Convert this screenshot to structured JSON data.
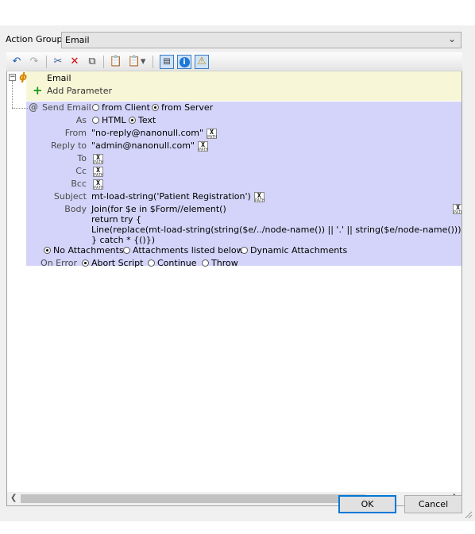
{
  "action_group": {
    "label": "Action Group:",
    "value": "Email"
  },
  "toolbar": {
    "undo": "undo-icon",
    "redo": "redo-icon",
    "cut": "cut-icon",
    "delete": "delete-icon",
    "copy": "copy-icon",
    "paste": "paste-icon",
    "paste_special": "paste-dropdown-icon",
    "view": "view-icon",
    "info": "info-icon",
    "warning": "warning-icon"
  },
  "tree": {
    "root_label": "Email",
    "add_parameter": "Add Parameter",
    "send_email": {
      "at": "@",
      "label": "Send Email",
      "from_client": "from Client",
      "from_server": "from Server",
      "as_label": "As",
      "html": "HTML",
      "text": "Text",
      "from_label": "From",
      "from_value": "\"no-reply@nanonull.com\"",
      "reply_to_label": "Reply to",
      "reply_to_value": "\"admin@nanonull.com\"",
      "to_label": "To",
      "cc_label": "Cc",
      "bcc_label": "Bcc",
      "subject_label": "Subject",
      "subject_value": "mt-load-string('Patient Registration')",
      "body_label": "Body",
      "body_lines": [
        "Join(for $e in $Form//element()",
        "return try {",
        "Line(replace(mt-load-string(string($e/../node-name()) || '.' || string($e/node-name())), '\\\\n', '&",
        "} catch * {()})"
      ],
      "no_attachments": "No Attachments",
      "attachments_below": "Attachments listed below",
      "dynamic_attachments": "Dynamic Attachments",
      "on_error_label": "On Error",
      "abort_script": "Abort Script",
      "continue": "Continue",
      "throw": "Throw"
    },
    "xpath_top": "X",
    "xpath_bottom": "PATH"
  },
  "buttons": {
    "ok": "OK",
    "cancel": "Cancel"
  },
  "colors": {
    "root_bg": "#f7f7d7",
    "step_bg": "#d4d4fa",
    "default_button_border": "#0078d7"
  }
}
